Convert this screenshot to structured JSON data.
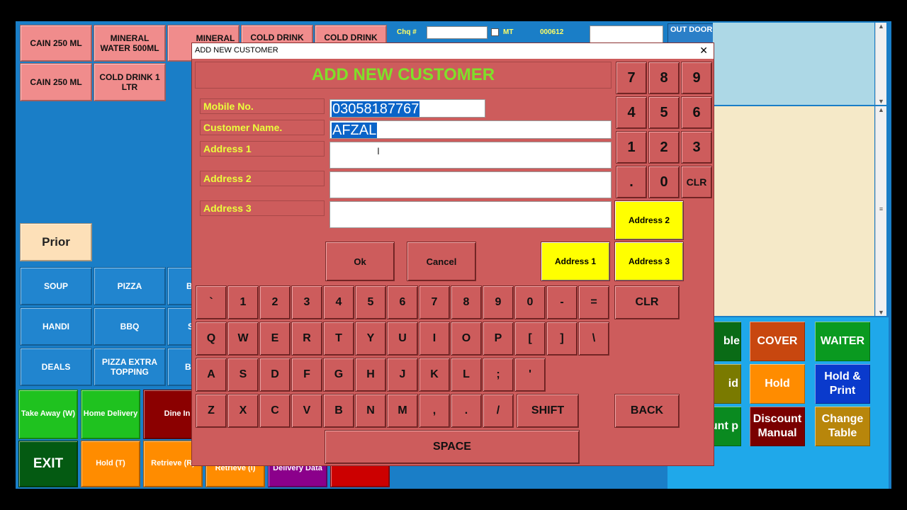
{
  "pos": {
    "products": [
      "CAIN 250 ML",
      "MINERAL WATER 500ML",
      "MINERAL WATER",
      "COLD DRINK",
      "COLD DRINK",
      "CAIN 250 ML",
      "COLD DRINK 1 LTR"
    ],
    "prior": "Prior",
    "categories": [
      "SOUP",
      "PIZZA",
      "B",
      "HANDI",
      "BBQ",
      "S",
      "DEALS",
      "PIZZA EXTRA TOPPING",
      "B T"
    ],
    "order_types": [
      "Take Away (W)",
      "Home Delivery",
      "Dine In (N"
    ],
    "exit": "EXIT",
    "bottom": [
      "Hold (T)",
      "Retrieve (R)",
      "Retrieve (I)",
      "Delivery Data",
      ""
    ],
    "chq_label": "Chq #",
    "mt_label": "MT",
    "order_no": "000612",
    "out_door": "OUT DOOR",
    "right_buttons": [
      "ble",
      "COVER",
      "WAITER",
      "id",
      "Hold",
      "Hold & Print",
      "ount p",
      "Discount Manual",
      "Change Table"
    ]
  },
  "dialog": {
    "window_title": "ADD NEW CUSTOMER",
    "close_glyph": "✕",
    "heading": "ADD NEW CUSTOMER",
    "fields": {
      "mobile_label": "Mobile No.",
      "mobile_value": "03058187767",
      "name_label": "Customer Name.",
      "name_value": "AFZAL",
      "address1_label": "Address 1",
      "address1_value": "",
      "address2_label": "Address 2",
      "address2_value": "",
      "address3_label": "Address 3",
      "address3_value": ""
    },
    "numpad": [
      "7",
      "8",
      "9",
      "4",
      "5",
      "6",
      "1",
      "2",
      "3",
      ".",
      "0",
      "CLR"
    ],
    "ok": "Ok",
    "cancel": "Cancel",
    "addr_buttons": {
      "address1": "Address 1",
      "address2": "Address 2",
      "address3": "Address 3"
    },
    "keyboard": {
      "row1": [
        "`",
        "1",
        "2",
        "3",
        "4",
        "5",
        "6",
        "7",
        "8",
        "9",
        "0",
        "-",
        "="
      ],
      "row2": [
        "Q",
        "W",
        "E",
        "R",
        "T",
        "Y",
        "U",
        "I",
        "O",
        "P",
        "[",
        "]",
        "\\"
      ],
      "row3": [
        "A",
        "S",
        "D",
        "F",
        "G",
        "H",
        "J",
        "K",
        "L",
        ";",
        "'"
      ],
      "row4": [
        "Z",
        "X",
        "C",
        "V",
        "B",
        "N",
        "M",
        ",",
        ".",
        "/"
      ],
      "clr": "CLR",
      "shift": "SHIFT",
      "back": "BACK",
      "space": "SPACE"
    }
  }
}
